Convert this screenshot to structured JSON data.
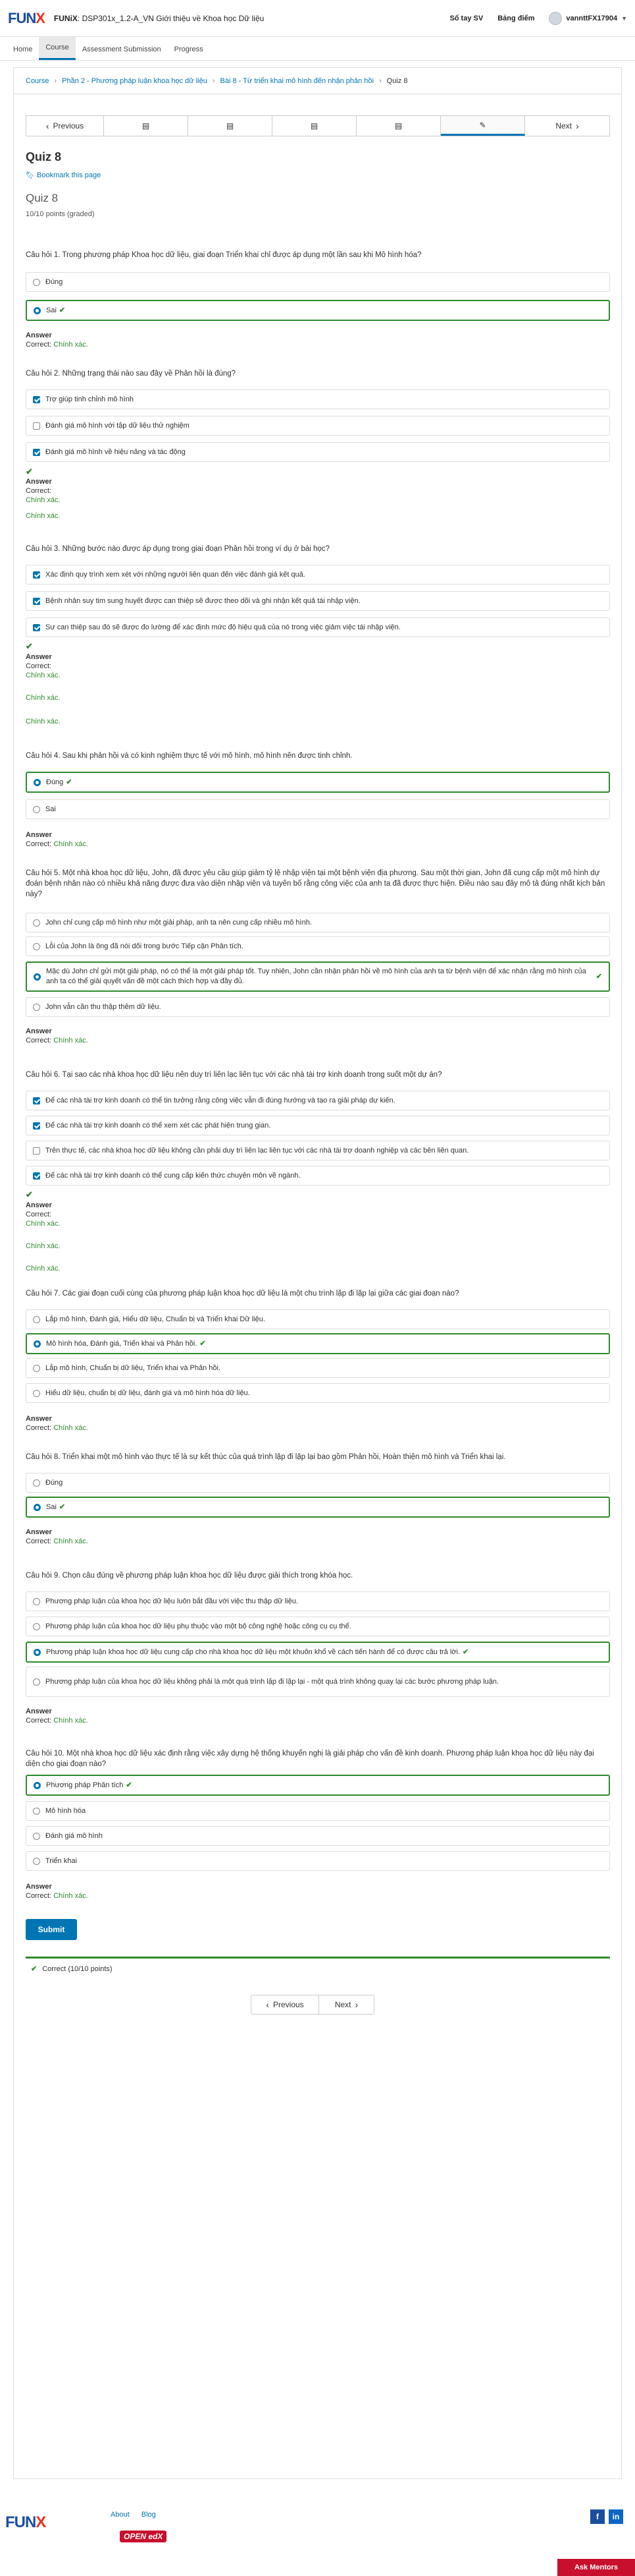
{
  "header": {
    "logo": "FUN",
    "logo_x": "X",
    "course_code": "FUNiX",
    "course_name": "DSP301x_1.2-A_VN Giới thiệu về Khoa học Dữ liệu",
    "links": [
      "Sổ tay SV",
      "Bảng điểm"
    ],
    "username": "vannttFX17904"
  },
  "tabs": [
    "Home",
    "Course",
    "Assessment Submission",
    "Progress"
  ],
  "breadcrumb": [
    "Course",
    "Phần 2 - Phương pháp luận khoa học dữ liệu",
    "Bài 8 - Từ triển khai mô hình đến nhận phản hồi",
    "Quiz 8"
  ],
  "seqnav": {
    "prev": "Previous",
    "next": "Next"
  },
  "unit": {
    "title": "Quiz 8",
    "bookmark": "Bookmark this page",
    "problem_title": "Quiz 8",
    "points": "10/10 points (graded)"
  },
  "answer_labels": {
    "answer": "Answer",
    "correct": "Correct:",
    "correct_value": "Chính xác."
  },
  "questions": [
    {
      "text": "Câu hỏi 1. Trong phương pháp Khoa học dữ liệu, giai đoạn Triển khai chỉ được áp dụng một lần sau khi Mô hình hóa?",
      "options": [
        "Đúng",
        "Sai"
      ]
    },
    {
      "text": "Câu hỏi 2. Những trạng thái nào sau đây về Phản hồi là đúng?",
      "options": [
        "Trợ giúp tinh chỉnh mô hình",
        "Đánh giá mô hình với tập dữ liệu thử nghiệm",
        "Đánh giá mô hình về hiệu năng và tác động"
      ]
    },
    {
      "text": "Câu hỏi 3. Những bước nào được áp dụng trong giai đoạn Phản hồi trong ví dụ ở bài học?",
      "options": [
        "Xác định quy trình xem xét với những người liên quan đến việc đánh giá kết quả.",
        "Bệnh nhân suy tim sung huyết được can thiệp sẽ được theo dõi và ghi nhận kết quả tái nhập viện.",
        "Sự can thiệp sau đó sẽ được đo lường để xác định mức độ hiệu quả của nó trong việc giảm việc tái nhập viện."
      ]
    },
    {
      "text": "Câu hỏi 4. Sau khi phản hồi và có kinh nghiệm thực tế với mô hình, mô hình nên được tinh chỉnh.",
      "options": [
        "Đúng",
        "Sai"
      ]
    },
    {
      "text": "Câu hỏi 5. Một nhà khoa học dữ liệu, John, đã được yêu cầu giúp giảm tỷ lệ nhập viện tại một bệnh viện địa phương. Sau một thời gian, John đã cung cấp một mô hình dự đoán bệnh nhân nào có nhiều khả năng được đưa vào diện nhập viện và tuyên bố rằng công việc của anh ta đã được thực hiện. Điều nào sau đây mô tả đúng nhất kịch bản này?",
      "options": [
        "John chỉ cung cấp mô hình như một giải pháp, anh ta nên cung cấp nhiều mô hình.",
        "Lỗi của John là ông đã nói dối trong bước Tiếp cận Phân tích.",
        "Mặc dù John chỉ gửi một giải pháp, nó có thể là một giải pháp tốt. Tuy nhiên, John cần nhận phản hồi về mô hình của anh ta từ bệnh viện để xác nhận rằng mô hình của anh ta có thể giải quyết vấn đề một cách thích hợp và đầy đủ.",
        "John vẫn cần thu thập thêm dữ liệu."
      ]
    },
    {
      "text": "Câu hỏi 6. Tại sao các nhà khoa học dữ liệu nên duy trì liên lạc liên tục với các nhà tài trợ kinh doanh trong suốt một dự án?",
      "options": [
        "Để các nhà tài trợ kinh doanh có thể tin tưởng rằng công việc vẫn đi đúng hướng và tạo ra giải pháp dự kiến.",
        "Để các nhà tài trợ kinh doanh có thể xem xét các phát hiện trung gian.",
        "Trên thực tế, các nhà khoa học dữ liệu không cần phải duy trì liên lạc liên tục với các nhà tài trợ doanh nghiệp và các bên liên quan.",
        "Để các nhà tài trợ kinh doanh có thể cung cấp kiến thức chuyên môn về ngành."
      ]
    },
    {
      "text": "Câu hỏi 7. Các giai đoạn cuối cùng của phương pháp luận khoa học dữ liệu là một chu trình lặp đi lặp lại giữa các giai đoạn nào?",
      "options": [
        "Lắp mô hình, Đánh giá, Hiểu dữ liệu, Chuẩn bị và Triển khai Dữ liệu.",
        "Mô hình hóa, Đánh giá, Triển khai và Phản hồi.",
        "Lắp mô hình, Chuẩn bị dữ liệu, Triển khai và Phản hồi.",
        "Hiểu dữ liệu, chuẩn bị dữ liệu, đánh giá và mô hình hóa dữ liệu."
      ]
    },
    {
      "text": "Câu hỏi 8. Triển khai một mô hình vào thực tế là sự kết thúc của quá trình lặp đi lặp lại bao gồm Phản hồi, Hoàn thiện mô hình và Triển khai lại.",
      "options": [
        "Đúng",
        "Sai"
      ]
    },
    {
      "text": "Câu hỏi 9. Chọn câu đúng về phương pháp luận khoa học dữ liệu được giải thích trong khóa học.",
      "options": [
        "Phương pháp luận của khoa học dữ liệu luôn bắt đầu với việc thu thập dữ liệu.",
        "Phương pháp luận của khoa học dữ liệu phụ thuộc vào một bộ công nghệ hoặc công cụ cụ thể.",
        "Phương pháp luận khoa học dữ liệu cung cấp cho nhà khoa học dữ liệu một khuôn khổ về cách tiến hành để có được câu trả lời.",
        "Phương pháp luận của khoa học dữ liệu không phải là một quá trình lặp đi lặp lại - một quá trình không quay lại các bước phương pháp luận."
      ]
    },
    {
      "text": "Câu hỏi 10. Một nhà khoa học dữ liệu xác định rằng việc xây dựng hệ thống khuyến nghị là giải pháp cho vấn đề kinh doanh. Phương pháp luận khoa học dữ liệu này đại diện cho giai đoạn nào?",
      "options": [
        "Phương pháp Phân tích",
        "Mô hình hóa",
        "Đánh giá mô hình",
        "Triển khai"
      ]
    }
  ],
  "submit_label": "Submit",
  "final_status": "Correct (10/10 points)",
  "bottom_nav": {
    "prev": "Previous",
    "next": "Next"
  },
  "footer": {
    "logo": "FUN",
    "logo_x": "X",
    "links": [
      "About",
      "Blog"
    ],
    "openedx": "OPEN edX",
    "mentors": "Ask Mentors"
  }
}
